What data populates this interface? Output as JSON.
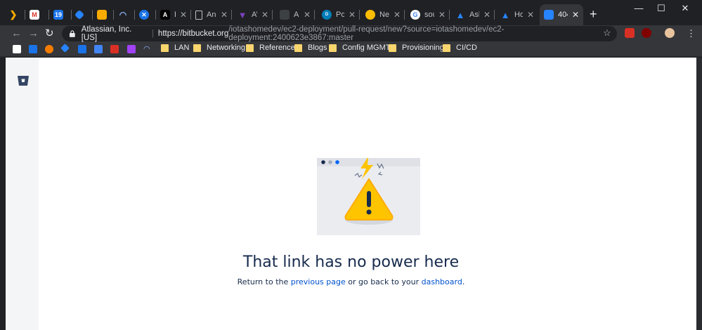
{
  "tabs": [
    {
      "title": "",
      "icon": "chevron-right-icon",
      "color": "#f9ab00"
    },
    {
      "title": "",
      "icon": "gmail-icon",
      "color": "#d93025"
    },
    {
      "title": "",
      "icon": "calendar-icon",
      "color": "#1a73e8"
    },
    {
      "title": "",
      "icon": "jira-icon",
      "color": "#2684ff"
    },
    {
      "title": "",
      "icon": "box-icon",
      "color": "#f9ab00"
    },
    {
      "title": "",
      "icon": "speedometer-icon",
      "color": "#8ab4f8"
    },
    {
      "title": "",
      "icon": "x-circle-icon",
      "color": "#1a73e8"
    },
    {
      "title": "Best",
      "icon": "ansible-a-icon",
      "color": "#000000"
    },
    {
      "title": "Ansi",
      "icon": "document-icon",
      "color": "#bdc1c6"
    },
    {
      "title": "AWS",
      "icon": "terraform-icon",
      "color": "#7b42bc"
    },
    {
      "title": "Ang",
      "icon": "dark-icon",
      "color": "#3c4043"
    },
    {
      "title": "Pow",
      "icon": "dell-icon",
      "color": "#007db8"
    },
    {
      "title": "New",
      "icon": "lemon-icon",
      "color": "#fbbc04"
    },
    {
      "title": "sou",
      "icon": "google-icon",
      "color": "#ffffff"
    },
    {
      "title": "Ask",
      "icon": "atlassian-icon",
      "color": "#2684ff"
    },
    {
      "title": "How",
      "icon": "atlassian-icon",
      "color": "#2684ff"
    },
    {
      "title": "404",
      "icon": "bitbucket-icon",
      "color": "#2684ff"
    }
  ],
  "toolbar": {
    "org": "Atlassian, Inc. [US]",
    "url_host": "https://bitbucket.org",
    "url_path": "/iotashomedev/ec2-deployment/pull-request/new?source=iotashomedev/ec2-deployment:2400623e3867:master"
  },
  "bookmarks": {
    "folders": [
      "LAN",
      "Networking",
      "Reference",
      "Blogs",
      "Config MGMT",
      "Provisioning",
      "CI/CD"
    ]
  },
  "page": {
    "headline": "That link has no power here",
    "text_before": "Return to the ",
    "link_previous": "previous page",
    "text_middle": " or go back to your ",
    "link_dashboard": "dashboard",
    "text_after": "."
  },
  "colors": {
    "accent": "#0052cc",
    "heading": "#172b4d",
    "warning": "#ffc400"
  }
}
